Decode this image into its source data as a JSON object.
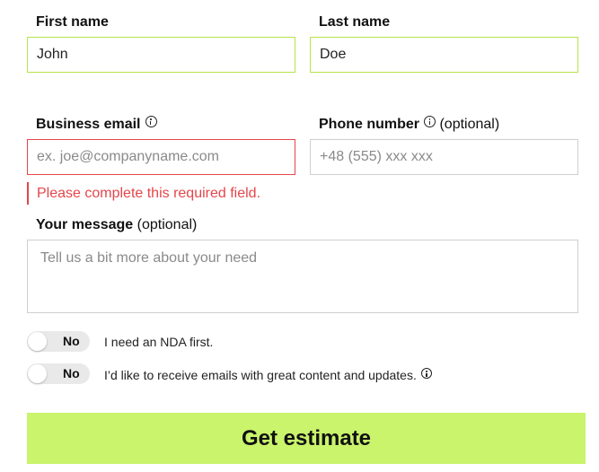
{
  "form": {
    "first_name": {
      "label": "First name",
      "value": "John"
    },
    "last_name": {
      "label": "Last name",
      "value": "Doe"
    },
    "business_email": {
      "label": "Business email",
      "value": "",
      "placeholder": "ex. joe@companyname.com",
      "error": "Please complete this required field."
    },
    "phone_number": {
      "label": "Phone number",
      "optional_note": "(optional)",
      "value": "",
      "placeholder": "+48 (555) xxx xxx"
    },
    "message": {
      "label": "Your message",
      "optional_note": "(optional)",
      "value": "",
      "placeholder": "Tell us a bit more about your need"
    },
    "toggles": [
      {
        "state_label": "No",
        "text": "I need an NDA first."
      },
      {
        "state_label": "No",
        "text": "I’d like to receive emails with great content and updates."
      }
    ],
    "submit_label": "Get estimate"
  },
  "colors": {
    "valid_border": "#b6e34a",
    "error": "#e5454a",
    "accent": "#c9f46b"
  }
}
